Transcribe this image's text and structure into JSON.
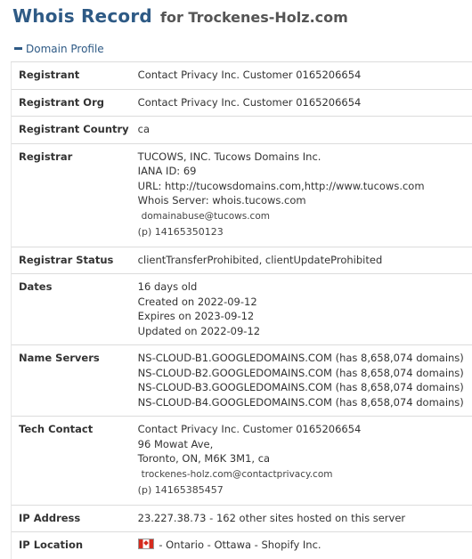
{
  "header": {
    "title": "Whois Record",
    "subtitle": "for Trockenes-Holz.com"
  },
  "section": {
    "toggle_label": "Domain Profile"
  },
  "rows": {
    "registrant": {
      "label": "Registrant",
      "value": "Contact Privacy Inc. Customer 0165206654"
    },
    "registrant_org": {
      "label": "Registrant Org",
      "value": "Contact Privacy Inc. Customer 0165206654"
    },
    "registrant_country": {
      "label": "Registrant Country",
      "value": "ca"
    },
    "registrar": {
      "label": "Registrar",
      "name": "TUCOWS, INC. Tucows Domains Inc.",
      "iana": "IANA ID: 69",
      "url": "URL: http://tucowsdomains.com,http://www.tucows.com",
      "whois_server": "Whois Server: whois.tucows.com",
      "email": "domainabuse@tucows.com",
      "phone_prefix": "(p)",
      "phone": "14165350123"
    },
    "registrar_status": {
      "label": "Registrar Status",
      "value": "clientTransferProhibited, clientUpdateProhibited"
    },
    "dates": {
      "label": "Dates",
      "age": "16 days old",
      "created": "Created on 2022-09-12",
      "expires": "Expires on 2023-09-12",
      "updated": "Updated on 2022-09-12"
    },
    "name_servers": {
      "label": "Name Servers",
      "ns1": "NS-CLOUD-B1.GOOGLEDOMAINS.COM (has 8,658,074 domains)",
      "ns2": "NS-CLOUD-B2.GOOGLEDOMAINS.COM (has 8,658,074 domains)",
      "ns3": "NS-CLOUD-B3.GOOGLEDOMAINS.COM (has 8,658,074 domains)",
      "ns4": "NS-CLOUD-B4.GOOGLEDOMAINS.COM (has 8,658,074 domains)"
    },
    "tech_contact": {
      "label": "Tech Contact",
      "name": "Contact Privacy Inc. Customer 0165206654",
      "street": "96 Mowat Ave,",
      "city": "Toronto, ON, M6K 3M1, ca",
      "email": "trockenes-holz.com@contactprivacy.com",
      "phone_prefix": "(p)",
      "phone": "14165385457"
    },
    "ip_address": {
      "label": "IP Address",
      "value": "23.227.38.73 - 162 other sites hosted on this server"
    },
    "ip_location": {
      "label": "IP Location",
      "flag_icon": "canada-flag-icon",
      "value": "- Ontario - Ottawa - Shopify Inc."
    }
  },
  "colors": {
    "title": "#2e5a85",
    "subtitle": "#555555",
    "border": "#dcdcdc",
    "text": "#333333"
  }
}
